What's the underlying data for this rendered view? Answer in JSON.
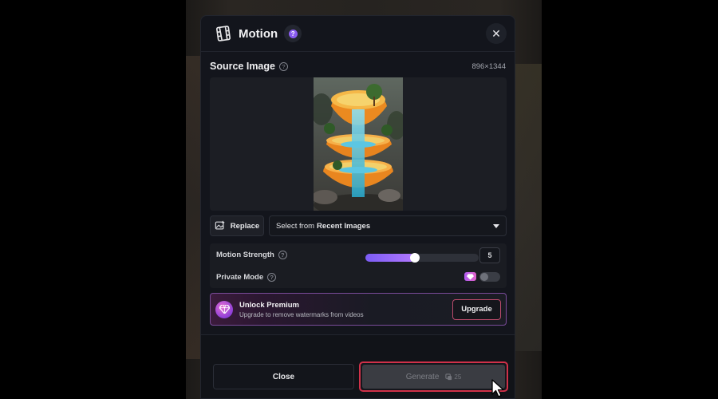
{
  "modal": {
    "title": "Motion",
    "help_icon": "question-icon",
    "close_icon": "close-icon"
  },
  "source": {
    "label": "Source Image",
    "dimensions": "896×1344",
    "image_semantic": "orange-slice-waterfall-image"
  },
  "actions": {
    "replace_label": "Replace",
    "select_prefix": "Select from",
    "select_bold": "Recent Images"
  },
  "settings": {
    "motion_strength_label": "Motion Strength",
    "motion_strength_value": "5",
    "motion_strength_fraction": 0.44,
    "private_mode_label": "Private Mode",
    "private_mode_on": false
  },
  "premium": {
    "title": "Unlock Premium",
    "subtitle": "Upgrade to remove watermarks from videos",
    "upgrade_label": "Upgrade"
  },
  "footer": {
    "close_label": "Close",
    "generate_label": "Generate",
    "generate_cost": "25"
  },
  "colors": {
    "accent_purple": "#8a5cf0",
    "highlight_red": "#d03149",
    "premium_pink": "#e061c9"
  }
}
